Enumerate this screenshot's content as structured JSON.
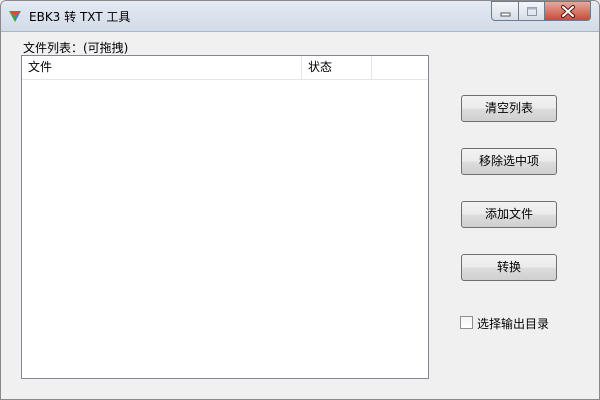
{
  "window": {
    "title": "EBK3 转 TXT 工具",
    "app_icon": "app-logo-icon",
    "controls": [
      "minimize-icon",
      "maximize-icon",
      "close-icon"
    ]
  },
  "file_list": {
    "caption": "文件列表：(可拖拽)",
    "columns": [
      "文件",
      "状态"
    ],
    "rows": []
  },
  "buttons": {
    "clear": "清空列表",
    "remove": "移除选中项",
    "add": "添加文件",
    "convert": "转换"
  },
  "output_dir_checkbox": {
    "label": "选择输出目录",
    "checked": false
  },
  "colors": {
    "close_button": "#c74d3a",
    "titlebar": "#d2dbe8",
    "client": "#f0f0f0"
  }
}
